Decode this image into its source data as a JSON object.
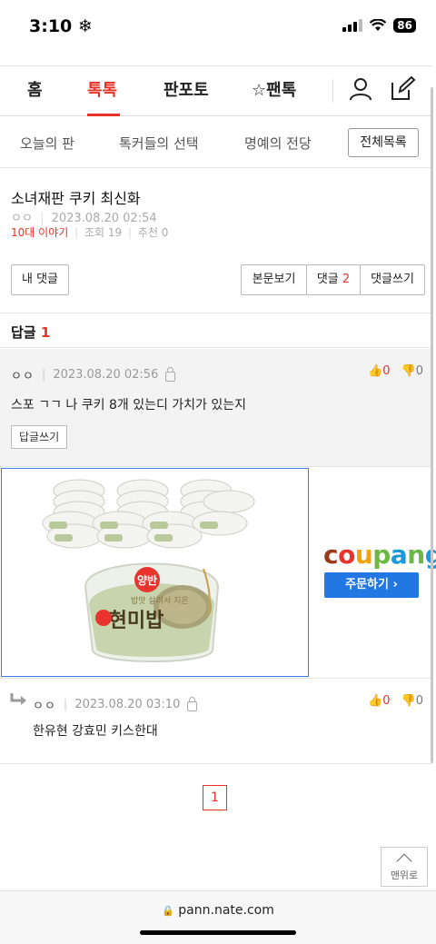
{
  "status": {
    "time": "3:10",
    "battery": "86"
  },
  "nav": {
    "items": [
      "홈",
      "톡톡",
      "판포토",
      "☆팬톡"
    ]
  },
  "subnav": {
    "items": [
      "오늘의 판",
      "톡커들의 선택",
      "명예의 전당"
    ],
    "all_label": "전체목록"
  },
  "post": {
    "title": "소녀재판 쿠키 최신화",
    "author": "ㅇㅇ",
    "date": "2023.08.20 02:54",
    "category": "10대 이야기",
    "views": "조회 19",
    "recommends": "추천 0"
  },
  "buttons": {
    "my_comments": "내 댓글",
    "view_post": "본문보기",
    "comments_label": "댓글",
    "comments_count": "2",
    "write_comment": "댓글쓰기"
  },
  "replies": {
    "label": "답글",
    "count": "1"
  },
  "comments": [
    {
      "author": "ㅇㅇ",
      "date": "2023.08.20 02:56",
      "text": "스포 ㄱㄱ 나 쿠키 8개 있는디 가치가 있는지",
      "up": "0",
      "down": "0",
      "reply_label": "답글쓰기"
    },
    {
      "author": "ㅇㅇ",
      "date": "2023.08.20 03:10",
      "text": "한유현 강효민 키스한대",
      "up": "0",
      "down": "0"
    }
  ],
  "ad": {
    "brand": "coupang",
    "order_label": "주문하기 ›",
    "product_brand": "양반",
    "product_name": "현미밥",
    "product_tagline": "밥맛 살려서 지은",
    "colors": {
      "coupang": [
        "#9b3b1c",
        "#e8342d",
        "#f2a20b",
        "#6ab943",
        "#1c99d8"
      ]
    }
  },
  "pagination": {
    "current": "1"
  },
  "top_button": "맨위로",
  "urlbar": {
    "url": "pann.nate.com"
  },
  "colors": {
    "accent": "#e63228",
    "link_blue": "#2277e3"
  }
}
